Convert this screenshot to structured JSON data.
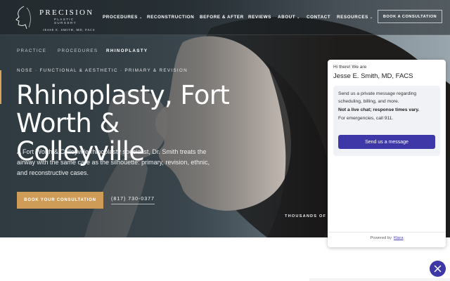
{
  "brand": {
    "name": "PRECISION",
    "subtitle": "PLASTIC SURGERY",
    "doctor": "JESSE E. SMITH, MD, FACS"
  },
  "nav": {
    "items": [
      {
        "label": "PROCEDURES",
        "chevron": true
      },
      {
        "label": "RECONSTRUCTION",
        "chevron": false
      },
      {
        "label": "BEFORE & AFTER",
        "chevron": false
      },
      {
        "label": "REVIEWS",
        "chevron": false
      },
      {
        "label": "ABOUT",
        "chevron": true
      },
      {
        "label": "CONTACT",
        "chevron": false
      },
      {
        "label": "RESOURCES",
        "chevron": true
      }
    ],
    "cta": "BOOK A CONSULTATION"
  },
  "breadcrumb": [
    "PRACTICE",
    "PROCEDURES",
    "RHINOPLASTY"
  ],
  "hero": {
    "eyebrow": "NOSE · FUNCTIONAL & AESTHETIC · PRIMARY & REVISION",
    "title_line1": "Rhinoplasty, Fort",
    "title_line2": "Worth & Colleyville",
    "intro": "A Fort Worth & Colleyville rhinoplasty specialist, Dr. Smith treats the airway with the same care as the silhouette: primary, revision, ethnic, and reconstructive cases.",
    "book_button": "BOOK YOUR CONSULTATION",
    "phone": "(817) 730-0377",
    "thousands_text": "THOUSANDS OF R"
  },
  "chat_widget": {
    "greeting": "Hi there! We are",
    "name": "Jesse E. Smith, MD, FACS",
    "line1": "Send us a private message regarding",
    "line2": "scheduling, billing, and more.",
    "line3": "Not a live chat; response times vary.",
    "line4": "For emergencies, call 911.",
    "button": "Send us a message",
    "powered_by": "Powered by",
    "powered_brand": "Klara"
  },
  "colors": {
    "accent_gold": "#cf9c58",
    "widget_purple": "#3d37a7"
  },
  "icons": {
    "logo": "profile-line-icon",
    "nav_chevron": "chevron-down-icon",
    "chat_close": "close-icon"
  }
}
